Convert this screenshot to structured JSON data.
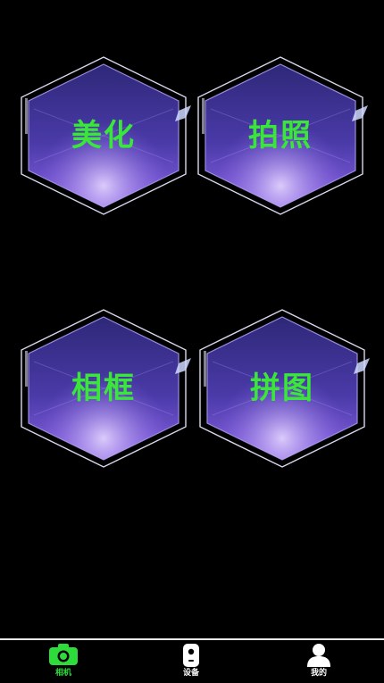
{
  "colors": {
    "background": "#000000",
    "tile_label": "#39e639",
    "tab_active": "#2ddc3a",
    "tab_inactive": "#ffffff",
    "hex_fill_top": "#3a2f8f",
    "hex_fill_bottom": "#7a56d8",
    "hex_outline": "#cfcfe6"
  },
  "tiles": [
    {
      "label": "美化",
      "icon": "hexagon-frame"
    },
    {
      "label": "拍照",
      "icon": "hexagon-frame"
    },
    {
      "label": "相框",
      "icon": "hexagon-frame"
    },
    {
      "label": "拼图",
      "icon": "hexagon-frame"
    }
  ],
  "tabbar": {
    "tabs": [
      {
        "label": "相机",
        "icon": "camera-icon",
        "active": true
      },
      {
        "label": "设备",
        "icon": "device-icon",
        "active": false
      },
      {
        "label": "我的",
        "icon": "user-icon",
        "active": false
      }
    ]
  }
}
